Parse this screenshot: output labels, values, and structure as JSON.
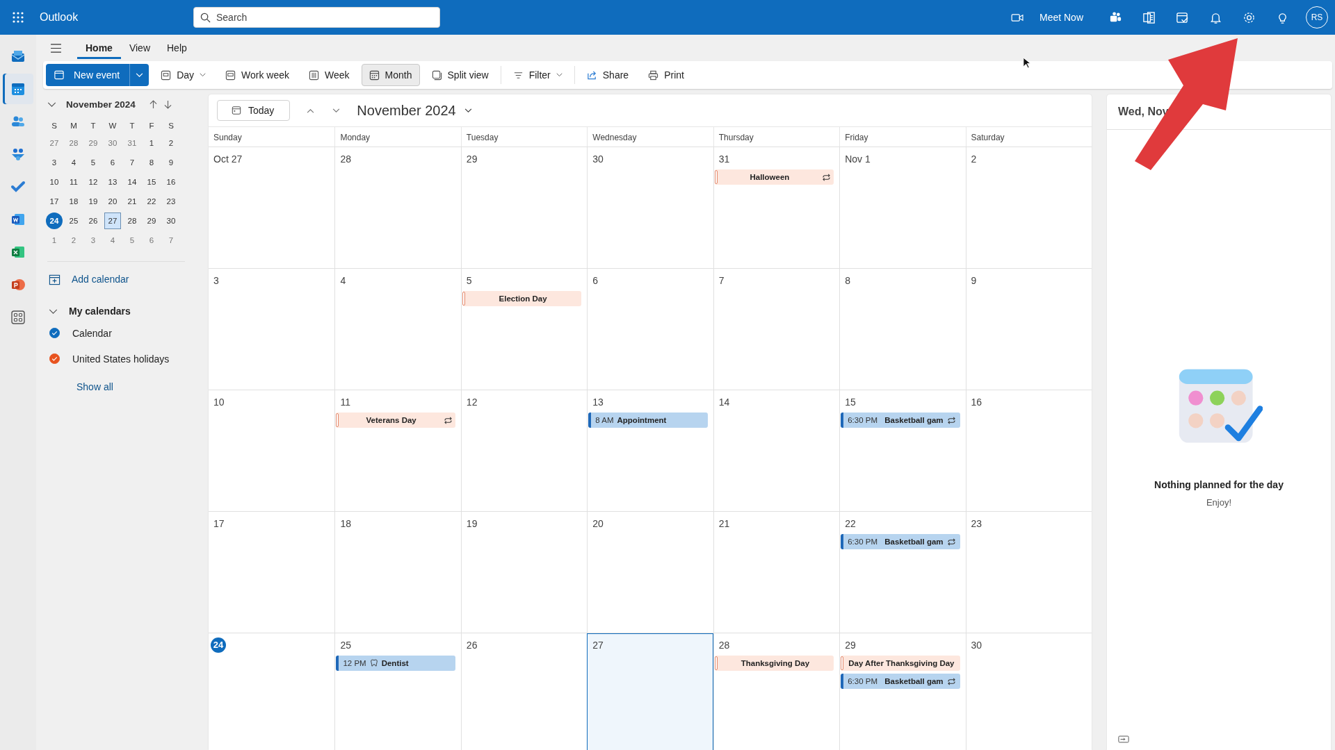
{
  "app": {
    "name": "Outlook",
    "search_placeholder": "Search",
    "meet_now": "Meet Now",
    "avatar": "RS"
  },
  "app_rail": [
    {
      "selected": false
    },
    {
      "selected": true
    },
    {
      "selected": false
    },
    {
      "selected": false
    },
    {
      "selected": false
    },
    {
      "selected": false
    },
    {
      "selected": false
    },
    {
      "selected": false
    },
    {
      "selected": false
    }
  ],
  "ribbon_tabs": [
    {
      "label": "Home",
      "selected": true
    },
    {
      "label": "View",
      "selected": false
    },
    {
      "label": "Help",
      "selected": false
    }
  ],
  "new_event": "New event",
  "toolbar": [
    {
      "label": "Day",
      "selected": false,
      "dropdown": true
    },
    {
      "label": "Work week",
      "selected": false,
      "dropdown": false
    },
    {
      "label": "Week",
      "selected": false,
      "dropdown": false
    },
    {
      "label": "Month",
      "selected": true,
      "dropdown": false
    },
    {
      "label": "Split view",
      "selected": false,
      "dropdown": false
    },
    {
      "label": "Filter",
      "selected": false,
      "dropdown": true
    },
    {
      "label": "Share",
      "selected": false,
      "dropdown": false
    },
    {
      "label": "Print",
      "selected": false,
      "dropdown": false
    }
  ],
  "mini_calendar": {
    "title": "November 2024",
    "weekdays": [
      "S",
      "M",
      "T",
      "W",
      "T",
      "F",
      "S"
    ],
    "weeks": [
      [
        {
          "d": "27",
          "outside": true,
          "today": false,
          "selected": false
        },
        {
          "d": "28",
          "outside": true,
          "today": false,
          "selected": false
        },
        {
          "d": "29",
          "outside": true,
          "today": false,
          "selected": false
        },
        {
          "d": "30",
          "outside": true,
          "today": false,
          "selected": false
        },
        {
          "d": "31",
          "outside": true,
          "today": false,
          "selected": false
        },
        {
          "d": "1",
          "outside": false,
          "today": false,
          "selected": false
        },
        {
          "d": "2",
          "outside": false,
          "today": false,
          "selected": false
        }
      ],
      [
        {
          "d": "3",
          "outside": false,
          "today": false,
          "selected": false
        },
        {
          "d": "4",
          "outside": false,
          "today": false,
          "selected": false
        },
        {
          "d": "5",
          "outside": false,
          "today": false,
          "selected": false
        },
        {
          "d": "6",
          "outside": false,
          "today": false,
          "selected": false
        },
        {
          "d": "7",
          "outside": false,
          "today": false,
          "selected": false
        },
        {
          "d": "8",
          "outside": false,
          "today": false,
          "selected": false
        },
        {
          "d": "9",
          "outside": false,
          "today": false,
          "selected": false
        }
      ],
      [
        {
          "d": "10",
          "outside": false,
          "today": false,
          "selected": false
        },
        {
          "d": "11",
          "outside": false,
          "today": false,
          "selected": false
        },
        {
          "d": "12",
          "outside": false,
          "today": false,
          "selected": false
        },
        {
          "d": "13",
          "outside": false,
          "today": false,
          "selected": false
        },
        {
          "d": "14",
          "outside": false,
          "today": false,
          "selected": false
        },
        {
          "d": "15",
          "outside": false,
          "today": false,
          "selected": false
        },
        {
          "d": "16",
          "outside": false,
          "today": false,
          "selected": false
        }
      ],
      [
        {
          "d": "17",
          "outside": false,
          "today": false,
          "selected": false
        },
        {
          "d": "18",
          "outside": false,
          "today": false,
          "selected": false
        },
        {
          "d": "19",
          "outside": false,
          "today": false,
          "selected": false
        },
        {
          "d": "20",
          "outside": false,
          "today": false,
          "selected": false
        },
        {
          "d": "21",
          "outside": false,
          "today": false,
          "selected": false
        },
        {
          "d": "22",
          "outside": false,
          "today": false,
          "selected": false
        },
        {
          "d": "23",
          "outside": false,
          "today": false,
          "selected": false
        }
      ],
      [
        {
          "d": "24",
          "outside": false,
          "today": true,
          "selected": false
        },
        {
          "d": "25",
          "outside": false,
          "today": false,
          "selected": false
        },
        {
          "d": "26",
          "outside": false,
          "today": false,
          "selected": false
        },
        {
          "d": "27",
          "outside": false,
          "today": false,
          "selected": true
        },
        {
          "d": "28",
          "outside": false,
          "today": false,
          "selected": false
        },
        {
          "d": "29",
          "outside": false,
          "today": false,
          "selected": false
        },
        {
          "d": "30",
          "outside": false,
          "today": false,
          "selected": false
        }
      ],
      [
        {
          "d": "1",
          "outside": true,
          "today": false,
          "selected": false
        },
        {
          "d": "2",
          "outside": true,
          "today": false,
          "selected": false
        },
        {
          "d": "3",
          "outside": true,
          "today": false,
          "selected": false
        },
        {
          "d": "4",
          "outside": true,
          "today": false,
          "selected": false
        },
        {
          "d": "5",
          "outside": true,
          "today": false,
          "selected": false
        },
        {
          "d": "6",
          "outside": true,
          "today": false,
          "selected": false
        },
        {
          "d": "7",
          "outside": true,
          "today": false,
          "selected": false
        }
      ]
    ]
  },
  "add_calendar": "Add calendar",
  "my_calendars": {
    "title": "My calendars",
    "expanded": true
  },
  "calendars": [
    {
      "name": "Calendar",
      "color": "#0f6cbd",
      "checked": true
    },
    {
      "name": "United States holidays",
      "color": "#e8531f",
      "checked": true
    }
  ],
  "show_all": "Show all",
  "calendar": {
    "today_button": "Today",
    "title": "November 2024",
    "weekdays": [
      "Sunday",
      "Monday",
      "Tuesday",
      "Wednesday",
      "Thursday",
      "Friday",
      "Saturday"
    ],
    "weeks": [
      {
        "days": [
          {
            "label": "Oct 27",
            "today": false,
            "selected": false
          },
          {
            "label": "28",
            "today": false,
            "selected": false
          },
          {
            "label": "29",
            "today": false,
            "selected": false
          },
          {
            "label": "30",
            "today": false,
            "selected": false
          },
          {
            "label": "31",
            "today": false,
            "selected": false,
            "events": [
              {
                "kind": "holiday",
                "title": "Halloween",
                "recurring": true
              }
            ]
          },
          {
            "label": "Nov 1",
            "today": false,
            "selected": false
          },
          {
            "label": "2",
            "today": false,
            "selected": false
          }
        ]
      },
      {
        "days": [
          {
            "label": "3",
            "today": false,
            "selected": false
          },
          {
            "label": "4",
            "today": false,
            "selected": false
          },
          {
            "label": "5",
            "today": false,
            "selected": false,
            "events": [
              {
                "kind": "holiday",
                "title": "Election Day",
                "recurring": false
              }
            ]
          },
          {
            "label": "6",
            "today": false,
            "selected": false
          },
          {
            "label": "7",
            "today": false,
            "selected": false
          },
          {
            "label": "8",
            "today": false,
            "selected": false
          },
          {
            "label": "9",
            "today": false,
            "selected": false
          }
        ]
      },
      {
        "days": [
          {
            "label": "10",
            "today": false,
            "selected": false
          },
          {
            "label": "11",
            "today": false,
            "selected": false,
            "events": [
              {
                "kind": "holiday",
                "title": "Veterans Day",
                "recurring": true
              }
            ]
          },
          {
            "label": "12",
            "today": false,
            "selected": false
          },
          {
            "label": "13",
            "today": false,
            "selected": false,
            "events": [
              {
                "kind": "meeting",
                "time": "8 AM",
                "title": "Appointment",
                "recurring": false
              }
            ]
          },
          {
            "label": "14",
            "today": false,
            "selected": false
          },
          {
            "label": "15",
            "today": false,
            "selected": false,
            "events": [
              {
                "kind": "sport",
                "time": "6:30 PM",
                "title": "Basketball gam",
                "recurring": true
              }
            ]
          },
          {
            "label": "16",
            "today": false,
            "selected": false
          }
        ]
      },
      {
        "days": [
          {
            "label": "17",
            "today": false,
            "selected": false
          },
          {
            "label": "18",
            "today": false,
            "selected": false
          },
          {
            "label": "19",
            "today": false,
            "selected": false
          },
          {
            "label": "20",
            "today": false,
            "selected": false
          },
          {
            "label": "21",
            "today": false,
            "selected": false
          },
          {
            "label": "22",
            "today": false,
            "selected": false,
            "events": [
              {
                "kind": "sport",
                "time": "6:30 PM",
                "title": "Basketball gam",
                "recurring": true
              }
            ]
          },
          {
            "label": "23",
            "today": false,
            "selected": false
          }
        ]
      },
      {
        "days": [
          {
            "label": "24",
            "today": true,
            "selected": false
          },
          {
            "label": "25",
            "today": false,
            "selected": false,
            "events": [
              {
                "kind": "dental",
                "time": "12 PM",
                "title": "Dentist",
                "recurring": false
              }
            ]
          },
          {
            "label": "26",
            "today": false,
            "selected": false
          },
          {
            "label": "27",
            "today": false,
            "selected": true
          },
          {
            "label": "28",
            "today": false,
            "selected": false,
            "events": [
              {
                "kind": "holiday",
                "title": "Thanksgiving Day",
                "recurring": false
              }
            ]
          },
          {
            "label": "29",
            "today": false,
            "selected": false,
            "events": [
              {
                "kind": "holiday",
                "title": "Day After Thanksgiving Day",
                "recurring": false
              },
              {
                "kind": "sport",
                "time": "6:30 PM",
                "title": "Basketball gam",
                "recurring": true
              }
            ]
          },
          {
            "label": "30",
            "today": false,
            "selected": false
          }
        ]
      }
    ]
  },
  "day_panel": {
    "title": "Wed, Nov",
    "empty_title": "Nothing planned for the day",
    "empty_subtitle": "Enjoy!"
  }
}
